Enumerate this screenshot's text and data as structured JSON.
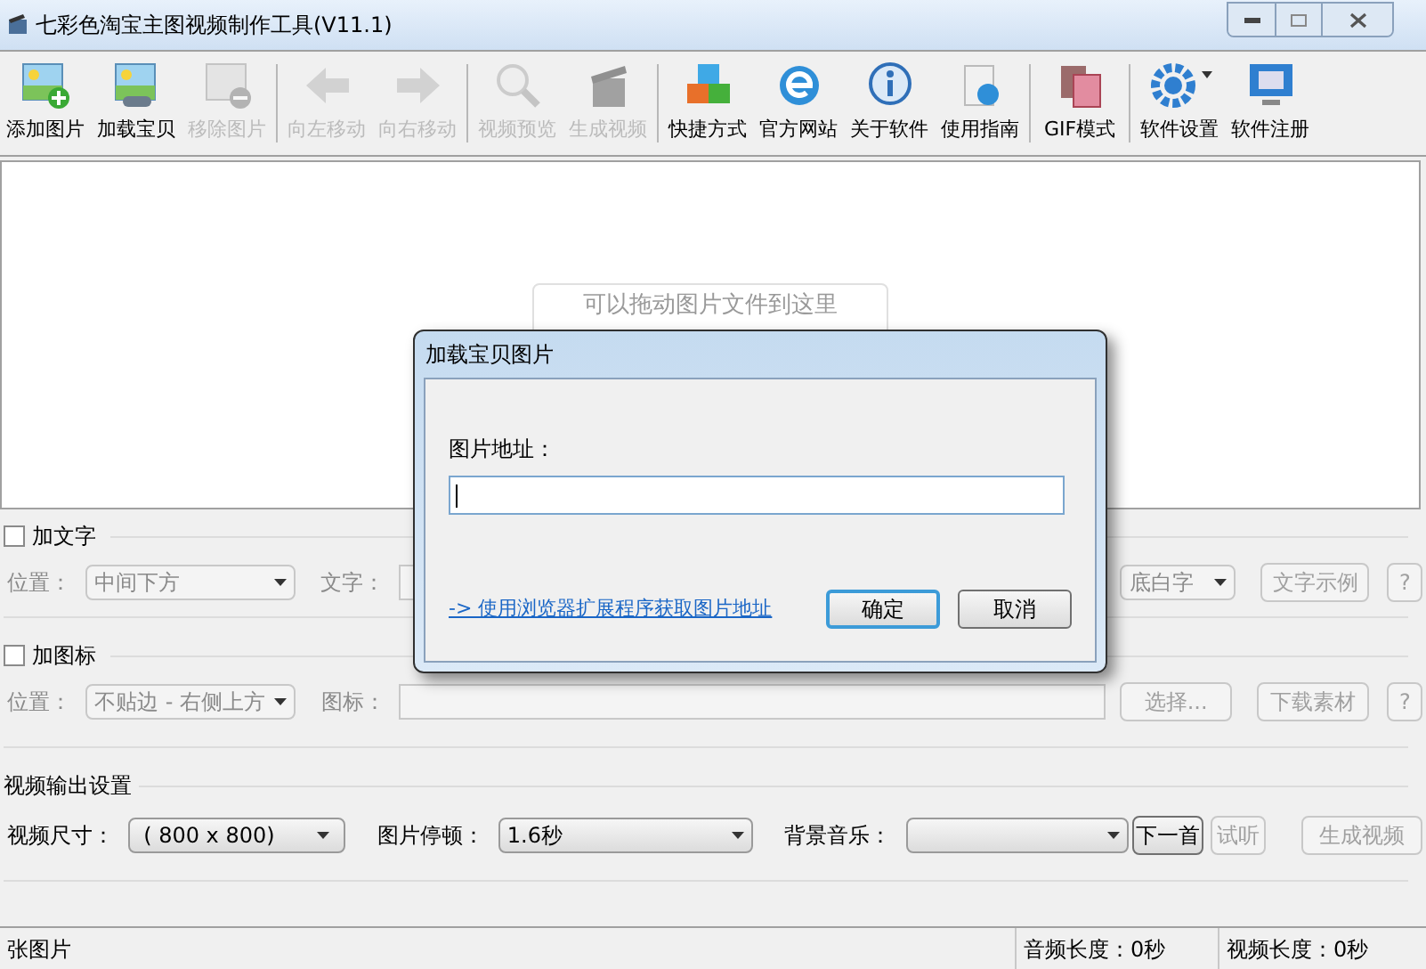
{
  "window": {
    "title": "七彩色淘宝主图视频制作工具(V11.1)"
  },
  "toolbar": [
    {
      "items": [
        {
          "label": "添加图片",
          "disabled": false,
          "has_menu": false
        },
        {
          "label": "加载宝贝",
          "disabled": false,
          "has_menu": false
        },
        {
          "label": "移除图片",
          "disabled": true,
          "has_menu": false
        }
      ]
    },
    {
      "items": [
        {
          "label": "向左移动",
          "disabled": true,
          "has_menu": false
        },
        {
          "label": "向右移动",
          "disabled": true,
          "has_menu": false
        }
      ]
    },
    {
      "items": [
        {
          "label": "视频预览",
          "disabled": true,
          "has_menu": false
        },
        {
          "label": "生成视频",
          "disabled": true,
          "has_menu": false
        }
      ]
    },
    {
      "items": [
        {
          "label": "快捷方式",
          "disabled": false,
          "has_menu": false
        },
        {
          "label": "官方网站",
          "disabled": false,
          "has_menu": false
        },
        {
          "label": "关于软件",
          "disabled": false,
          "has_menu": false
        },
        {
          "label": "使用指南",
          "disabled": false,
          "has_menu": false
        }
      ]
    },
    {
      "items": [
        {
          "label": "GIF模式",
          "disabled": false,
          "has_menu": false
        }
      ]
    },
    {
      "items": [
        {
          "label": "软件设置",
          "disabled": false,
          "has_menu": true
        },
        {
          "label": "软件注册",
          "disabled": false,
          "has_menu": false
        }
      ]
    }
  ],
  "drop_area": {
    "hint": "可以拖动图片文件到这里"
  },
  "text_overlay": {
    "title": "加文字",
    "checked": false,
    "position_label": "位置：",
    "position_value": "中间下方",
    "text_label": "文字：",
    "style_value": "底白字",
    "sample_button": "文字示例",
    "help_button": "?"
  },
  "icon_overlay": {
    "title": "加图标",
    "checked": false,
    "position_label": "位置：",
    "position_value": "不贴边 - 右侧上方",
    "icon_label": "图标：",
    "choose_button": "选择...",
    "download_button": "下载素材",
    "help_button": "?"
  },
  "video_output": {
    "title": "视频输出设置",
    "size_label": "视频尺寸：",
    "size_value": "( 800 x 800)",
    "pause_label": "图片停顿：",
    "pause_value": "1.6秒",
    "music_label": "背景音乐：",
    "next_button": {
      "label": "下一首",
      "disabled": false
    },
    "listen_button": {
      "label": "试听",
      "disabled": true
    },
    "generate_button": {
      "label": "生成视频",
      "disabled": true
    }
  },
  "status_bar": [
    "张图片",
    "音频长度：0秒",
    "视频长度：0秒"
  ],
  "dialog": {
    "title": "加载宝贝图片",
    "url_label": "图片地址：",
    "link": "-> 使用浏览器扩展程序获取图片地址",
    "buttons": [
      {
        "label": "确定",
        "default": true
      },
      {
        "label": "取消",
        "default": false
      }
    ]
  }
}
